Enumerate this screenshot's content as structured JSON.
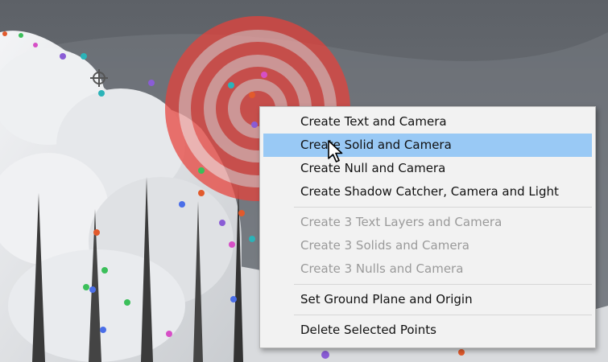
{
  "context_menu": {
    "groups": [
      [
        {
          "label": "Create Text and Camera",
          "enabled": true,
          "highlighted": false
        },
        {
          "label": "Create Solid and Camera",
          "enabled": true,
          "highlighted": true
        },
        {
          "label": "Create Null and Camera",
          "enabled": true,
          "highlighted": false
        },
        {
          "label": "Create Shadow Catcher, Camera and Light",
          "enabled": true,
          "highlighted": false
        }
      ],
      [
        {
          "label": "Create 3 Text Layers and Camera",
          "enabled": false,
          "highlighted": false
        },
        {
          "label": "Create 3 Solids and Camera",
          "enabled": false,
          "highlighted": false
        },
        {
          "label": "Create 3 Nulls and Camera",
          "enabled": false,
          "highlighted": false
        }
      ],
      [
        {
          "label": "Set Ground Plane and Origin",
          "enabled": true,
          "highlighted": false
        }
      ],
      [
        {
          "label": "Delete Selected Points",
          "enabled": true,
          "highlighted": false
        }
      ]
    ]
  },
  "colors": {
    "menu_background": "#f2f2f2",
    "menu_highlight": "#99c9f5",
    "target_red": "#e8413a",
    "disabled_text": "#9a9a9a"
  },
  "icons": {
    "cursor": "arrow-pointer-icon",
    "target": "bullseye-target-icon",
    "track_point": "track-point-icon",
    "origin": "crosshair-origin-icon"
  }
}
